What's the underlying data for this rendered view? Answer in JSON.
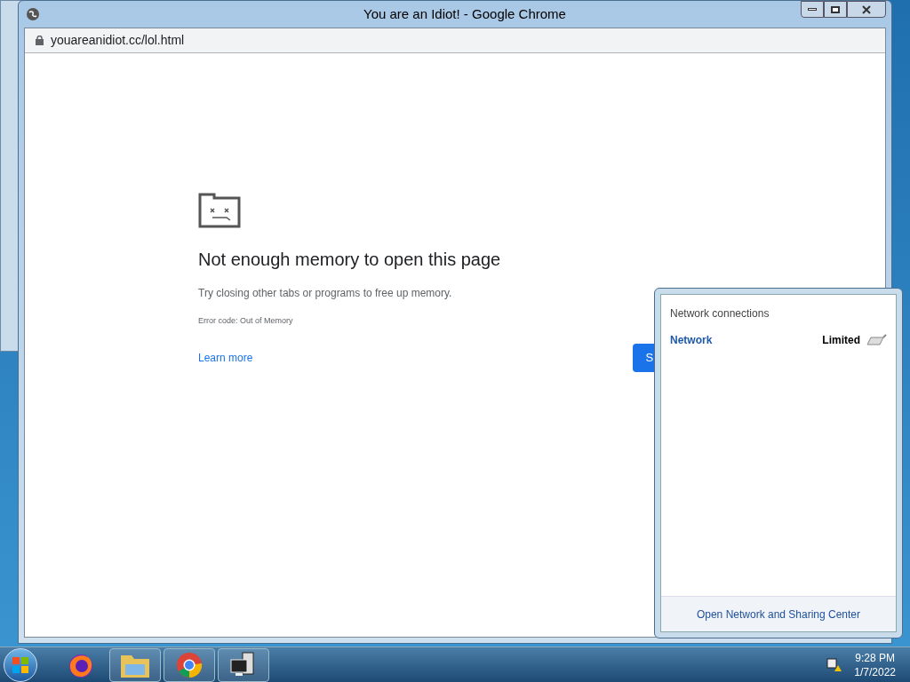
{
  "window": {
    "title": "You are an Idiot! - Google Chrome",
    "url": "youareanidiot.cc/lol.html"
  },
  "error_page": {
    "heading": "Not enough memory to open this page",
    "message": "Try closing other tabs or programs to free up memory.",
    "error_code": "Error code: Out of Memory",
    "link": "Learn more",
    "button": "S"
  },
  "network_popup": {
    "title": "Network connections",
    "networks": [
      {
        "name": "Network",
        "status": "Limited"
      }
    ],
    "footer_link": "Open Network and Sharing Center"
  },
  "taskbar": {
    "apps": [
      {
        "kind": "firefox"
      },
      {
        "kind": "folder"
      },
      {
        "kind": "chrome"
      },
      {
        "kind": "computer"
      }
    ]
  },
  "clock": {
    "time": "9:28 PM",
    "date": "1/7/2022"
  }
}
